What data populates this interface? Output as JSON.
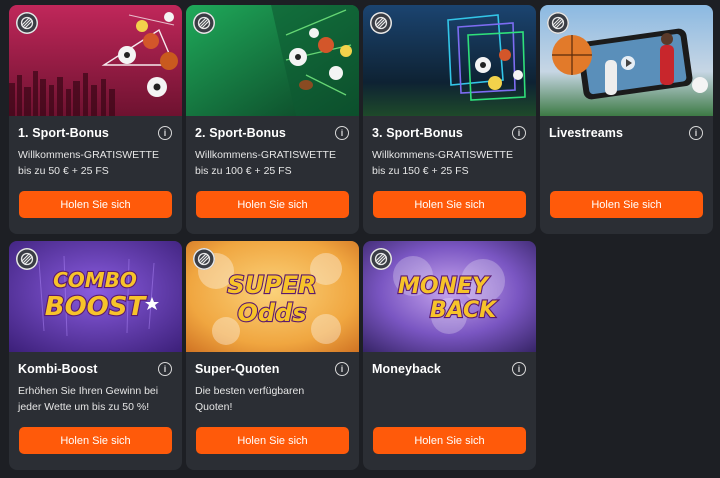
{
  "cards": [
    {
      "title": "1. Sport-Bonus",
      "desc": "Willkommens-GRATISWETTE\nbis zu 50 € + 25 FS",
      "button": "Holen Sie sich",
      "colors": {
        "top": "#b1204b",
        "bottom": "#6e1230"
      }
    },
    {
      "title": "2. Sport-Bonus",
      "desc": "Willkommens-GRATISWETTE\nbis zu 100 € + 25 FS",
      "button": "Holen Sie sich",
      "colors": {
        "top": "#19904e",
        "bottom": "#0b3f24"
      }
    },
    {
      "title": "3. Sport-Bonus",
      "desc": "Willkommens-GRATISWETTE\nbis zu 150 € + 25 FS",
      "button": "Holen Sie sich",
      "colors": {
        "top": "#173d63",
        "bottom": "#0d1e2c"
      }
    },
    {
      "title": "Livestreams",
      "desc": "",
      "button": "Holen Sie sich",
      "colors": {
        "top": "#6ea4d8",
        "bottom": "#2b5b3a"
      }
    },
    {
      "title": "Kombi-Boost",
      "desc": "Erhöhen Sie Ihren Gewinn bei\njeder Wette um bis zu 50 %!",
      "button": "Holen Sie sich",
      "colors": {
        "top": "#7b4fd1",
        "bottom": "#3b1f78"
      },
      "art": [
        "COMBO",
        "BOOST"
      ]
    },
    {
      "title": "Super-Quoten",
      "desc": "Die besten verfügbaren\nQuoten!",
      "button": "Holen Sie sich",
      "colors": {
        "top": "#f6b24a",
        "bottom": "#c9681d"
      },
      "art": [
        "SUPER",
        "Odds"
      ]
    },
    {
      "title": "Moneyback",
      "desc": "",
      "button": "Holen Sie sich",
      "colors": {
        "top": "#6b4ab0",
        "bottom": "#2b1c57"
      },
      "art": [
        "MONEY",
        "BACK"
      ]
    }
  ],
  "icons": {
    "sport": "sport-category-icon",
    "info": "info-icon"
  },
  "accent": "#ff5a0a",
  "info_glyph": "i"
}
